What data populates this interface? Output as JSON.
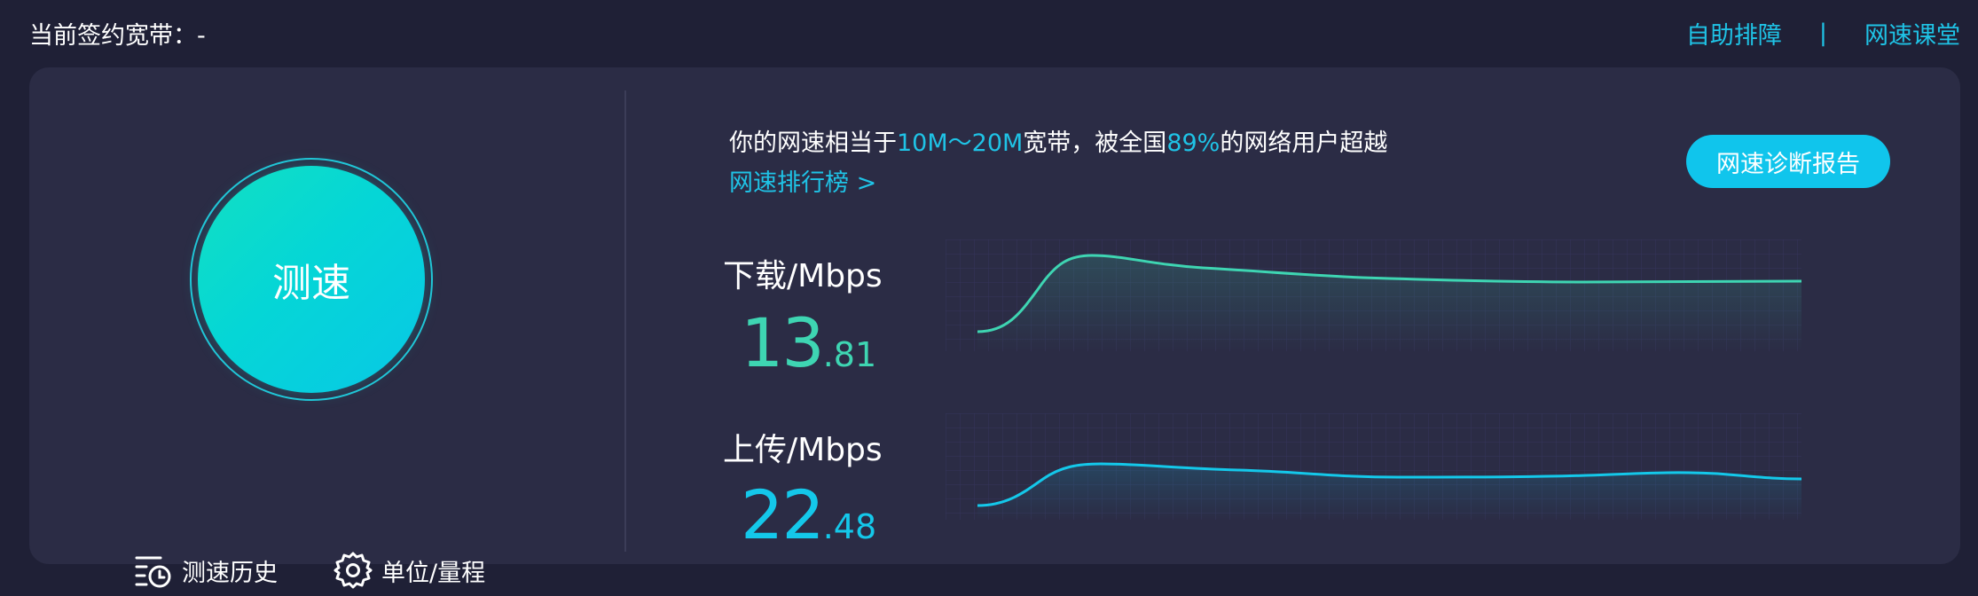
{
  "header": {
    "contract_label": "当前签约宽带：-",
    "links": {
      "self_help": "自助排障",
      "separator": "|",
      "classroom": "网速课堂"
    }
  },
  "left": {
    "speed_button": "测速",
    "history": "测速历史",
    "unit": "单位/量程"
  },
  "summary": {
    "prefix": "你的网速相当于",
    "bandwidth": "10M～20M",
    "middle": "宽带，被全国",
    "percent": "89%",
    "suffix": "的网络用户超越",
    "ranking_link": "网速排行榜 >"
  },
  "report_button": "网速诊断报告",
  "download": {
    "label": "下载/Mbps",
    "int": "13",
    "dec": ".81",
    "color": "#3ed5b2"
  },
  "upload": {
    "label": "上传/Mbps",
    "int": "22",
    "dec": ".48",
    "color": "#14c8ea"
  },
  "colors": {
    "accent": "#1fc3e6",
    "panel": "#2b2c45",
    "background": "#1f2036"
  }
}
